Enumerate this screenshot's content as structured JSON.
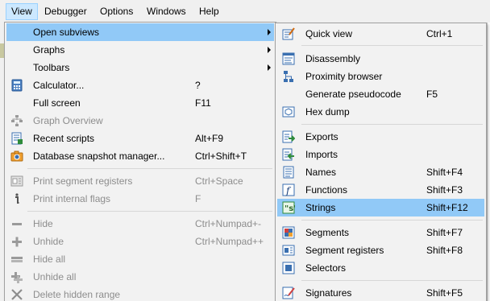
{
  "menubar": {
    "items": [
      {
        "label": "View"
      },
      {
        "label": "Debugger"
      },
      {
        "label": "Options"
      },
      {
        "label": "Windows"
      },
      {
        "label": "Help"
      }
    ]
  },
  "view_menu": {
    "items": [
      {
        "label": "Open subviews",
        "shortcut": "",
        "submenu": true
      },
      {
        "label": "Graphs",
        "shortcut": "",
        "submenu": true
      },
      {
        "label": "Toolbars",
        "shortcut": "",
        "submenu": true
      },
      {
        "label": "Calculator...",
        "shortcut": "?"
      },
      {
        "label": "Full screen",
        "shortcut": "F11"
      },
      {
        "label": "Graph Overview",
        "shortcut": ""
      },
      {
        "label": "Recent scripts",
        "shortcut": "Alt+F9"
      },
      {
        "label": "Database snapshot manager...",
        "shortcut": "Ctrl+Shift+T"
      },
      {
        "label": "Print segment registers",
        "shortcut": "Ctrl+Space"
      },
      {
        "label": "Print internal flags",
        "shortcut": "F"
      },
      {
        "label": "Hide",
        "shortcut": "Ctrl+Numpad+-"
      },
      {
        "label": "Unhide",
        "shortcut": "Ctrl+Numpad++"
      },
      {
        "label": "Hide all",
        "shortcut": ""
      },
      {
        "label": "Unhide all",
        "shortcut": ""
      },
      {
        "label": "Delete hidden range",
        "shortcut": ""
      }
    ]
  },
  "subviews_menu": {
    "items": [
      {
        "label": "Quick view",
        "shortcut": "Ctrl+1"
      },
      {
        "label": "Disassembly",
        "shortcut": ""
      },
      {
        "label": "Proximity browser",
        "shortcut": ""
      },
      {
        "label": "Generate pseudocode",
        "shortcut": "F5"
      },
      {
        "label": "Hex dump",
        "shortcut": ""
      },
      {
        "label": "Exports",
        "shortcut": ""
      },
      {
        "label": "Imports",
        "shortcut": ""
      },
      {
        "label": "Names",
        "shortcut": "Shift+F4"
      },
      {
        "label": "Functions",
        "shortcut": "Shift+F3"
      },
      {
        "label": "Strings",
        "shortcut": "Shift+F12"
      },
      {
        "label": "Segments",
        "shortcut": "Shift+F7"
      },
      {
        "label": "Segment registers",
        "shortcut": "Shift+F8"
      },
      {
        "label": "Selectors",
        "shortcut": ""
      },
      {
        "label": "Signatures",
        "shortcut": "Shift+F5"
      }
    ]
  }
}
